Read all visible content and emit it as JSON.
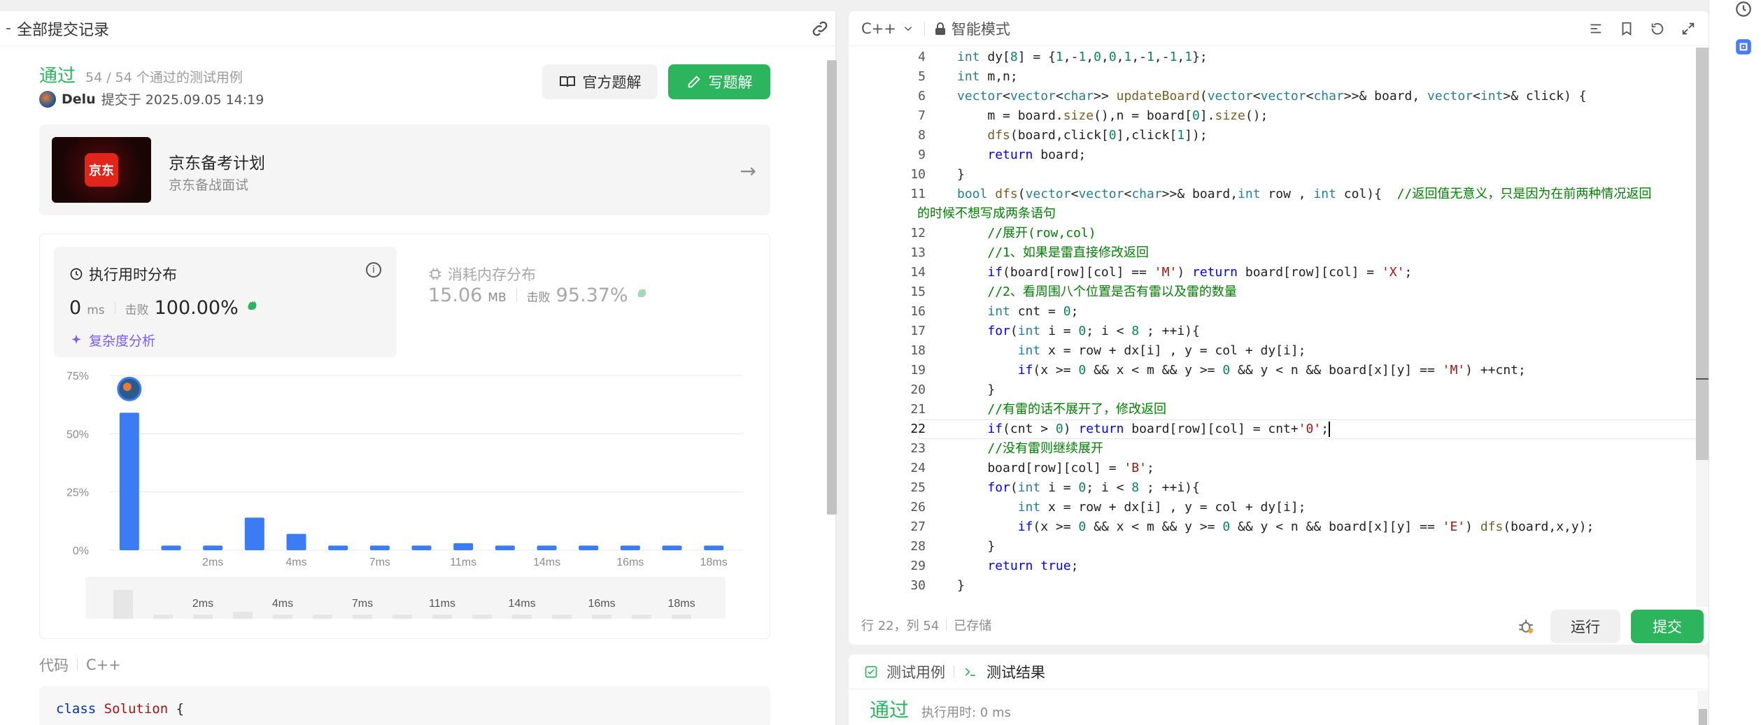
{
  "left_panel": {
    "back_symbol": "-",
    "title": "全部提交记录",
    "status": "通过",
    "cases": "54 / 54 个通过的测试用例",
    "author_name": "Delu",
    "submitted_text": "提交于 2025.09.05 14:19",
    "btn_official": "官方题解",
    "btn_write": "写题解",
    "promo_logo_text": "京东",
    "promo_title": "京东备考计划",
    "promo_sub": "京东备战面试",
    "time_title": "执行用时分布",
    "time_value": "0",
    "time_unit": "ms",
    "time_beat_label": "击败",
    "time_beat_pct": "100.00%",
    "complexity_label": "复杂度分析",
    "mem_title": "消耗内存分布",
    "mem_value": "15.06",
    "mem_unit": "MB",
    "mem_beat_label": "击败",
    "mem_beat_pct": "95.37%",
    "code_label": "代码",
    "code_lang": "C++",
    "code_first_kw": "class",
    "code_first_name": "Solution",
    "code_first_brace": "{"
  },
  "chart_data": {
    "type": "bar",
    "y_ticks": [
      "75%",
      "50%",
      "25%",
      "0%"
    ],
    "ylim": [
      0,
      75
    ],
    "x_tick_labels": [
      "2ms",
      "4ms",
      "7ms",
      "11ms",
      "14ms",
      "16ms",
      "18ms"
    ],
    "values": [
      59,
      2,
      2,
      14,
      7,
      2,
      2,
      2,
      3,
      2,
      2,
      2,
      2,
      2,
      2
    ],
    "highlight_index": 0,
    "colors": {
      "bar": "#3b7cf4",
      "grid": "#e8e8e8",
      "mini_bar": "#e6e6e6",
      "mini_bg": "#f5f5f5"
    }
  },
  "editor": {
    "lang": "C++",
    "mode": "智能模式",
    "footer_pos": "行 22，列 54",
    "footer_saved": "已存储",
    "run": "运行",
    "submit": "提交",
    "lines": [
      {
        "n": "4",
        "html": "<span class='t'>int</span> dy[<span class='n'>8</span>] = {<span class='n'>1</span>,-<span class='n'>1</span>,<span class='n'>0</span>,<span class='n'>0</span>,<span class='n'>1</span>,-<span class='n'>1</span>,-<span class='n'>1</span>,<span class='n'>1</span>};"
      },
      {
        "n": "5",
        "html": "<span class='t'>int</span> m,n;"
      },
      {
        "n": "6",
        "html": "<span class='t'>vector</span>&lt;<span class='t'>vector</span>&lt;<span class='t'>char</span>&gt;&gt; <span class='f'>updateBoard</span>(<span class='t'>vector</span>&lt;<span class='t'>vector</span>&lt;<span class='t'>char</span>&gt;&gt;&amp; board, <span class='t'>vector</span>&lt;<span class='t'>int</span>&gt;&amp; click) {"
      },
      {
        "n": "7",
        "html": "    m = board.<span class='f'>size</span>(),n = board[<span class='n'>0</span>].<span class='f'>size</span>();"
      },
      {
        "n": "8",
        "html": "    <span class='f'>dfs</span>(board,click[<span class='n'>0</span>],click[<span class='n'>1</span>]);"
      },
      {
        "n": "9",
        "html": "    <span class='k'>return</span> board;"
      },
      {
        "n": "10",
        "html": "}"
      },
      {
        "n": "11",
        "html": "<span class='t'>bool</span> <span class='f'>dfs</span>(<span class='t'>vector</span>&lt;<span class='t'>vector</span>&lt;<span class='t'>char</span>&gt;&gt;&amp; board,<span class='t'>int</span> row , <span class='t'>int</span> col){  <span class='c'>//返回值无意义，只是因为在前两种情况返回</span>",
        "wrap": "的时候不想写成两条语句"
      },
      {
        "n": "12",
        "html": "    <span class='c'>//展开(row,col)</span>"
      },
      {
        "n": "13",
        "html": "    <span class='c'>//1、如果是雷直接修改返回</span>"
      },
      {
        "n": "14",
        "html": "    <span class='k'>if</span>(board[row][col] == <span class='s'>'M'</span>) <span class='k'>return</span> board[row][col] = <span class='s'>'X'</span>;"
      },
      {
        "n": "15",
        "html": "    <span class='c'>//2、看周围八个位置是否有雷以及雷的数量</span>"
      },
      {
        "n": "16",
        "html": "    <span class='t'>int</span> cnt = <span class='n'>0</span>;"
      },
      {
        "n": "17",
        "html": "    <span class='k'>for</span>(<span class='t'>int</span> i = <span class='n'>0</span>; i &lt; <span class='n'>8</span> ; ++i){"
      },
      {
        "n": "18",
        "html": "        <span class='t'>int</span> x = row + dx[i] , y = col + dy[i];"
      },
      {
        "n": "19",
        "html": "        <span class='k'>if</span>(x &gt;= <span class='n'>0</span> &amp;&amp; x &lt; m &amp;&amp; y &gt;= <span class='n'>0</span> &amp;&amp; y &lt; n &amp;&amp; board[x][y] == <span class='s'>'M'</span>) ++cnt;"
      },
      {
        "n": "20",
        "html": "    }"
      },
      {
        "n": "21",
        "html": "    <span class='c'>//有雷的话不展开了，修改返回</span>"
      },
      {
        "n": "22",
        "html": "    <span class='k'>if</span>(cnt &gt; <span class='n'>0</span>) <span class='k'>return</span> board[row][col] = cnt+<span class='s'>'0'</span>;<span class='cursor'></span>",
        "active": true
      },
      {
        "n": "23",
        "html": "    <span class='c'>//没有雷则继续展开</span>"
      },
      {
        "n": "24",
        "html": "    board[row][col] = <span class='s'>'B'</span>;"
      },
      {
        "n": "25",
        "html": "    <span class='k'>for</span>(<span class='t'>int</span> i = <span class='n'>0</span>; i &lt; <span class='n'>8</span> ; ++i){"
      },
      {
        "n": "26",
        "html": "        <span class='t'>int</span> x = row + dx[i] , y = col + dy[i];"
      },
      {
        "n": "27",
        "html": "        <span class='k'>if</span>(x &gt;= <span class='n'>0</span> &amp;&amp; x &lt; m &amp;&amp; y &gt;= <span class='n'>0</span> &amp;&amp; y &lt; n &amp;&amp; board[x][y] == <span class='s'>'E'</span>) <span class='f'>dfs</span>(board,x,y);"
      },
      {
        "n": "28",
        "html": "    }"
      },
      {
        "n": "29",
        "html": "    <span class='k'>return</span> <span class='k'>true</span>;"
      },
      {
        "n": "30",
        "html": "}"
      }
    ]
  },
  "test_panel": {
    "tab_cases": "测试用例",
    "tab_result": "测试结果",
    "result_status": "通过",
    "result_sub": "执行用时: 0 ms"
  },
  "icons": {
    "link": "link-icon",
    "book": "book-icon",
    "edit": "edit-icon",
    "clock": "clock-icon",
    "info": "info-icon",
    "chip": "chip-icon",
    "sparkle": "sparkle-icon",
    "lock": "lock-icon",
    "chevron": "chevron-down-icon"
  }
}
